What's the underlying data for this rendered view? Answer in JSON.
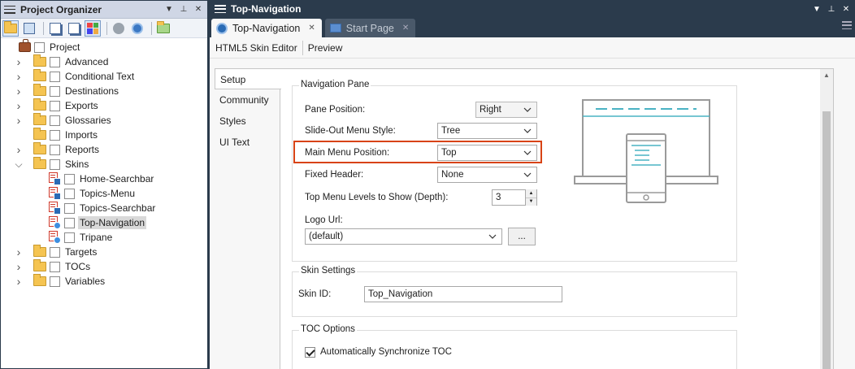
{
  "left_panel": {
    "title": "Project Organizer",
    "tree": [
      {
        "label": "Project",
        "type": "project",
        "depth": 0
      },
      {
        "label": "Advanced",
        "type": "folder",
        "depth": 1,
        "chevron": "right"
      },
      {
        "label": "Conditional Text",
        "type": "folder",
        "depth": 1,
        "chevron": "right"
      },
      {
        "label": "Destinations",
        "type": "folder",
        "depth": 1,
        "chevron": "right"
      },
      {
        "label": "Exports",
        "type": "folder",
        "depth": 1,
        "chevron": "right"
      },
      {
        "label": "Glossaries",
        "type": "folder",
        "depth": 1,
        "chevron": "right"
      },
      {
        "label": "Imports",
        "type": "folder",
        "depth": 1,
        "chevron": ""
      },
      {
        "label": "Reports",
        "type": "folder",
        "depth": 1,
        "chevron": "right"
      },
      {
        "label": "Skins",
        "type": "folder",
        "depth": 1,
        "chevron": "down"
      },
      {
        "label": "Home-Searchbar",
        "type": "skin",
        "depth": 2
      },
      {
        "label": "Topics-Menu",
        "type": "skin",
        "depth": 2
      },
      {
        "label": "Topics-Searchbar",
        "type": "skin",
        "depth": 2
      },
      {
        "label": "Top-Navigation",
        "type": "skin-r",
        "depth": 2,
        "selected": true
      },
      {
        "label": "Tripane",
        "type": "skin-r",
        "depth": 2
      },
      {
        "label": "Targets",
        "type": "folder",
        "depth": 1,
        "chevron": "right"
      },
      {
        "label": "TOCs",
        "type": "folder",
        "depth": 1,
        "chevron": "right"
      },
      {
        "label": "Variables",
        "type": "folder",
        "depth": 1,
        "chevron": "right"
      }
    ]
  },
  "right_panel": {
    "title": "Top-Navigation",
    "tabs": [
      {
        "label": "Top-Navigation",
        "active": true
      },
      {
        "label": "Start Page",
        "active": false
      }
    ],
    "toolbar": {
      "editor_label": "HTML5 Skin Editor",
      "preview_label": "Preview"
    },
    "side_tabs": [
      "Setup",
      "Community",
      "Styles",
      "UI Text"
    ],
    "navigation_pane": {
      "title": "Navigation Pane",
      "pane_position": {
        "label": "Pane Position:",
        "value": "Right"
      },
      "slide_out_menu_style": {
        "label": "Slide-Out Menu Style:",
        "value": "Tree"
      },
      "main_menu_position": {
        "label": "Main Menu Position:",
        "value": "Top"
      },
      "fixed_header": {
        "label": "Fixed Header:",
        "value": "None"
      },
      "top_menu_levels": {
        "label": "Top Menu Levels to Show (Depth):",
        "value": "3"
      },
      "logo_url": {
        "label": "Logo Url:",
        "value": "(default)",
        "browse_label": "..."
      }
    },
    "skin_settings": {
      "title": "Skin Settings",
      "skin_id_label": "Skin ID:",
      "skin_id_value": "Top_Navigation"
    },
    "toc_options": {
      "title": "TOC Options",
      "auto_sync_label": "Automatically Synchronize TOC",
      "auto_sync_checked": true
    }
  },
  "colors": {
    "title_bar": "#2b3b4c",
    "highlight": "#d84315",
    "preview_teal": "#4ab3c3"
  }
}
